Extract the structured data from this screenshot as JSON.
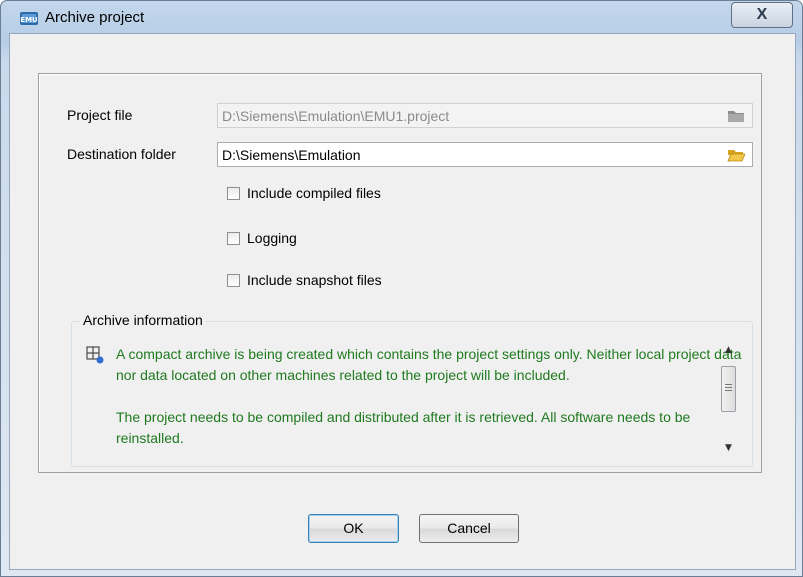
{
  "window": {
    "title": "Archive project",
    "close_label": "X"
  },
  "form": {
    "project_file_label": "Project file",
    "project_file_value": "D:\\Siemens\\Emulation\\EMU1.project",
    "destination_folder_label": "Destination folder",
    "destination_folder_value": "D:\\Siemens\\Emulation",
    "options": [
      {
        "label": "Include compiled files",
        "checked": false
      },
      {
        "label": "Logging",
        "checked": false
      },
      {
        "label": "Include snapshot files",
        "checked": false
      }
    ]
  },
  "archive_info": {
    "legend": "Archive information",
    "paragraph1": "A compact archive is being created which contains the project settings only. Neither local project data nor data located on other machines related to the project will be included.",
    "paragraph2": "The project needs to be compiled and distributed after it is retrieved. All software needs to be reinstalled."
  },
  "buttons": {
    "ok": "OK",
    "cancel": "Cancel"
  },
  "colors": {
    "info_text": "#1f7a1f",
    "title_gradient": "#b6cde6",
    "default_button_border": "#3c7fb1"
  },
  "icons": {
    "app": "emu-app-icon",
    "folder_disabled": "folder-icon",
    "folder_enabled": "open-folder-icon",
    "info": "tree-info-icon"
  }
}
